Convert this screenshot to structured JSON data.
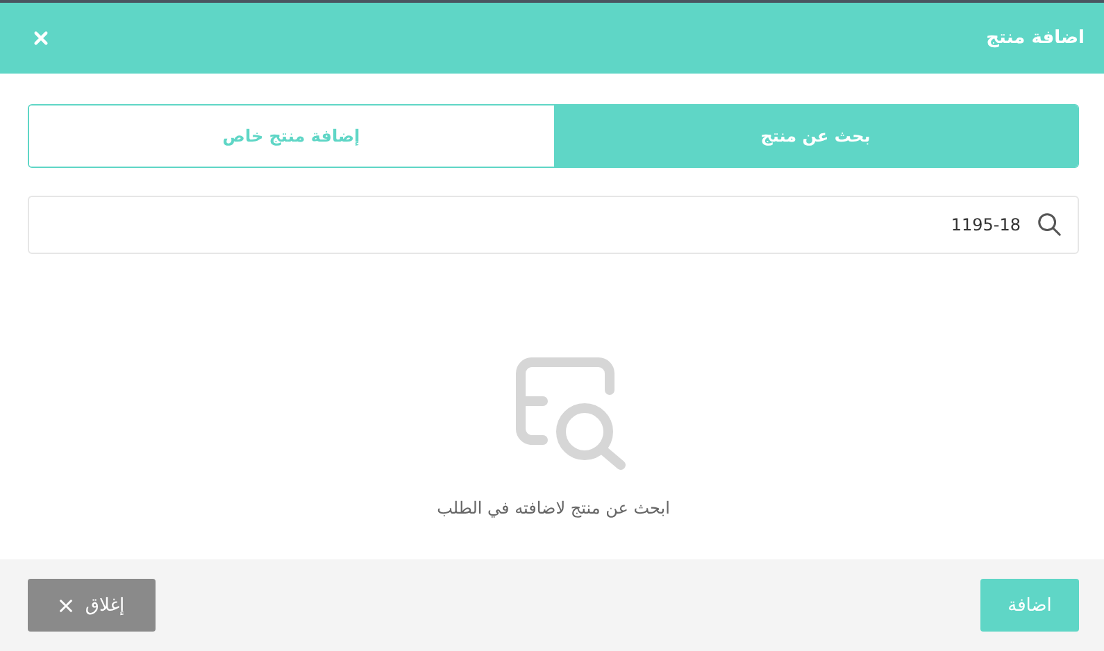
{
  "window": {
    "title": "اضافة منتج"
  },
  "tabs": [
    {
      "label": "بحث عن منتج",
      "selected": true
    },
    {
      "label": "إضافة منتج خاص",
      "selected": false
    }
  ],
  "search": {
    "value": "1195-18"
  },
  "empty_state": {
    "message": "ابحث عن منتج لاضافته في الطلب"
  },
  "buttons": [
    {
      "kind": "primary",
      "label": "اضافة"
    },
    {
      "kind": "close",
      "label": "إغلاق"
    }
  ]
}
